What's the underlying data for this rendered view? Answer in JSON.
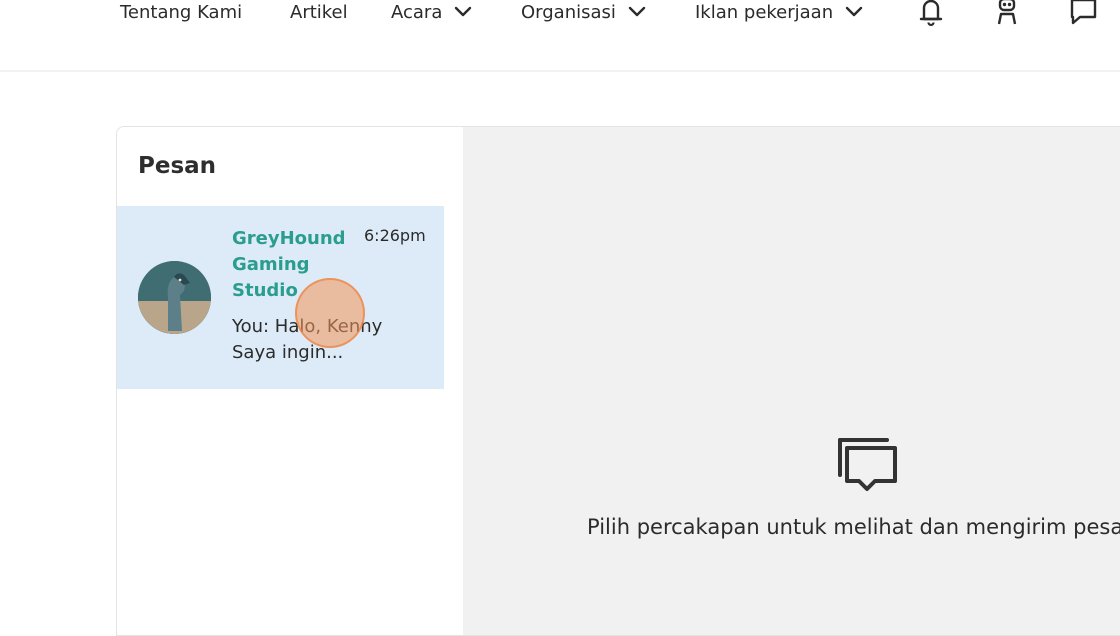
{
  "nav": {
    "items": [
      {
        "label": "Tentang Kami"
      },
      {
        "label": "Artikel"
      },
      {
        "label": "Acara"
      },
      {
        "label": "Organisasi"
      },
      {
        "label": "Iklan pekerjaan"
      }
    ],
    "icons": [
      "bell-icon",
      "robot-icon",
      "chat-bubble-icon",
      "chevron-down-icon"
    ]
  },
  "messages": {
    "title": "Pesan",
    "conversations": [
      {
        "name": "GreyHound Gaming Studio",
        "time": "6:26pm",
        "preview": "You: Halo, Kenny Saya ingin..."
      }
    ],
    "empty_state": "Pilih percakapan untuk melihat dan mengirim pesan"
  },
  "colors": {
    "accent": "#2a9d8f",
    "selected_bg": "#dcebf7",
    "detail_bg": "#f1f1f1"
  }
}
